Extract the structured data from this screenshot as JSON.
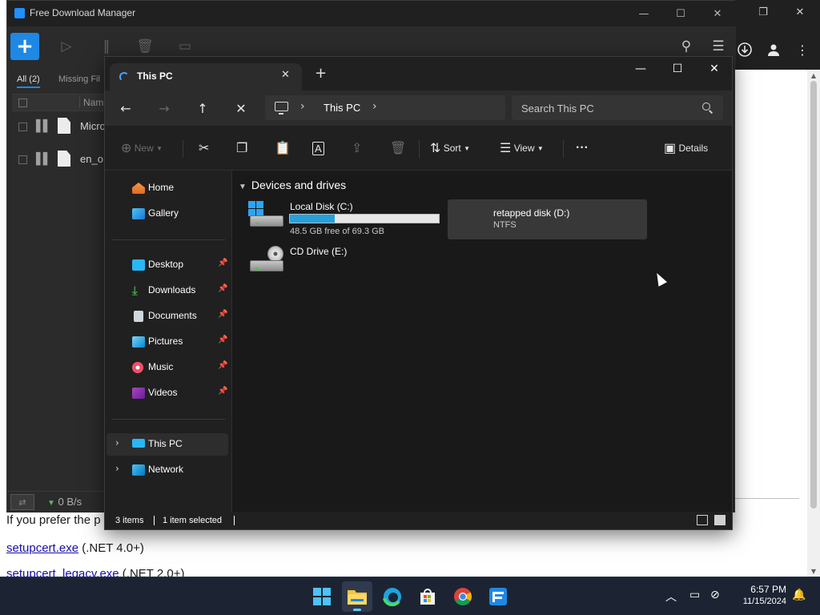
{
  "browser": {
    "page_lines": {
      "line1": "If you prefer the p",
      "link1": "setupcert.exe",
      "note1": " (.NET 4.0+)",
      "link2": "setupcert_legacy.exe",
      "note2": " (.NET 2.0+)"
    },
    "icons": [
      "download-icon",
      "profile-icon",
      "more-icon"
    ]
  },
  "fdm": {
    "title": "Free Download Manager",
    "tabs": {
      "all": "All (2)",
      "missing": "Missing Fil"
    },
    "columns": {
      "name": "Name"
    },
    "rows": [
      {
        "name": "Micro"
      },
      {
        "name": "en_o"
      }
    ],
    "speed": "0 B/s"
  },
  "explorer": {
    "tab_title": "This PC",
    "address": {
      "crumb": "This PC"
    },
    "search": {
      "placeholder": "Search This PC"
    },
    "commands": {
      "new": "New",
      "sort": "Sort",
      "view": "View",
      "more": "···",
      "details": "Details"
    },
    "nav": {
      "home": "Home",
      "gallery": "Gallery",
      "desktop": "Desktop",
      "downloads": "Downloads",
      "documents": "Documents",
      "pictures": "Pictures",
      "music": "Music",
      "videos": "Videos",
      "this_pc": "This PC",
      "network": "Network"
    },
    "group_header": "Devices and drives",
    "drives": [
      {
        "name": "Local Disk (C:)",
        "sub": "48.5 GB free of 69.3 GB",
        "used_fraction": 0.3
      },
      {
        "name": "retapped disk (D:)",
        "sub": "NTFS"
      },
      {
        "name": "CD Drive (E:)"
      }
    ],
    "status": {
      "items": "3 items",
      "selected": "1 item selected"
    }
  },
  "taskbar": {
    "time": "6:57 PM",
    "date": "11/15/2024",
    "apps": [
      "start-icon",
      "file-explorer-icon",
      "edge-icon",
      "store-icon",
      "chrome-icon",
      "fdm-icon"
    ]
  },
  "colors": {
    "accent": "#26a0da",
    "fdm_blue": "#1e88e5",
    "taskbar": "#1c2433"
  }
}
